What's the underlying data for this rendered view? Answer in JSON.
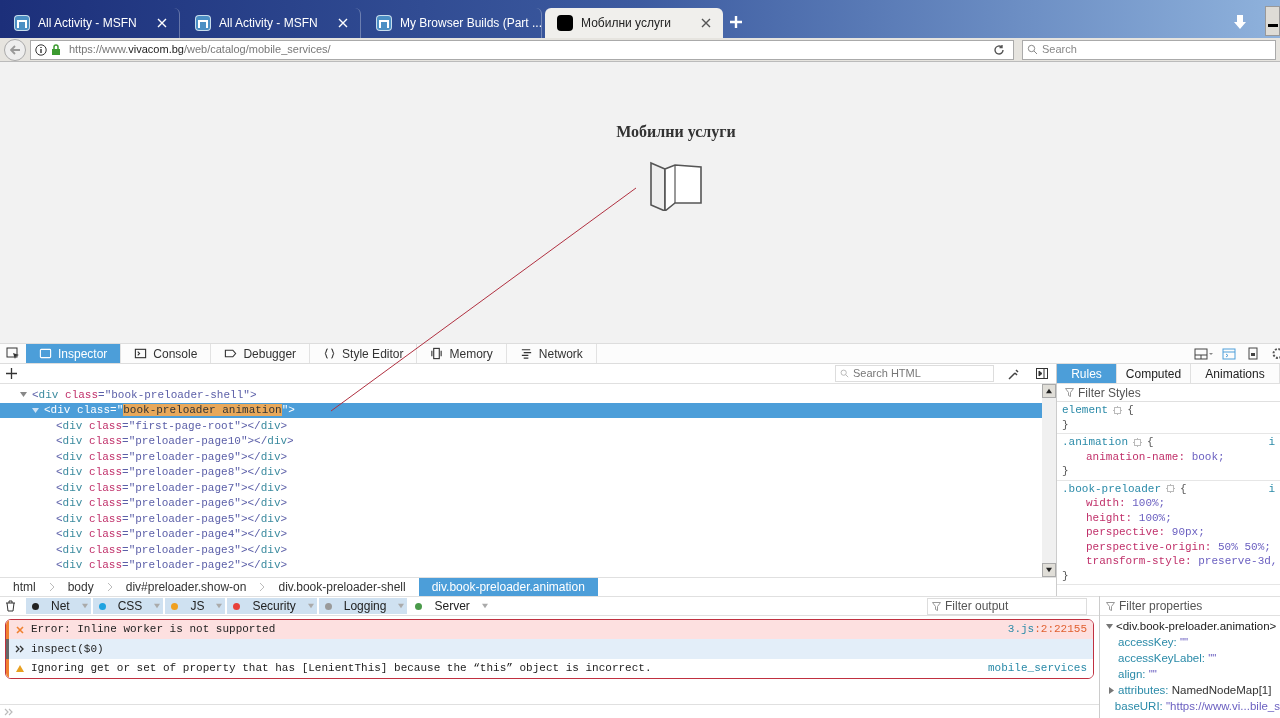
{
  "browser_tabs": [
    {
      "title": "All Activity - MSFN",
      "kind": "forum",
      "selected": false
    },
    {
      "title": "All Activity - MSFN",
      "kind": "forum",
      "selected": false
    },
    {
      "title": "My Browser Builds (Part ...",
      "kind": "forum",
      "selected": false
    },
    {
      "title": "Мобилни услуги",
      "kind": "dark",
      "selected": true
    }
  ],
  "address": {
    "prefix": "https://www.",
    "host": "vivacom.bg",
    "path": "/web/catalog/mobile_services/"
  },
  "search": {
    "placeholder": "Search"
  },
  "page": {
    "heading": "Мобилни услуги"
  },
  "devtools": {
    "tabs": [
      {
        "label": "Inspector",
        "kind": "inspector",
        "selected": true
      },
      {
        "label": "Console",
        "kind": "console",
        "selected": false
      },
      {
        "label": "Debugger",
        "kind": "debugger",
        "selected": false
      },
      {
        "label": "Style Editor",
        "kind": "braces",
        "selected": false
      },
      {
        "label": "Memory",
        "kind": "memory",
        "selected": false
      },
      {
        "label": "Network",
        "kind": "network",
        "selected": false
      }
    ],
    "markup": {
      "search_placeholder": "Search HTML",
      "nodes": [
        {
          "line": "<div class=\"book-preloader-shell\">",
          "expanded": true,
          "selected": false,
          "children": [
            {
              "line": "<div class=\"book-preloader animation\">",
              "expanded": true,
              "selected": true,
              "children": [
                {
                  "line": "<div class=\"first-page-root\"></div>",
                  "selected": false
                },
                {
                  "line": "<div class=\"preloader-page10\"></div>",
                  "selected": false
                },
                {
                  "line": "<div class=\"preloader-page9\"></div>",
                  "selected": false
                },
                {
                  "line": "<div class=\"preloader-page8\"></div>",
                  "selected": false
                },
                {
                  "line": "<div class=\"preloader-page7\"></div>",
                  "selected": false
                },
                {
                  "line": "<div class=\"preloader-page6\"></div>",
                  "selected": false
                },
                {
                  "line": "<div class=\"preloader-page5\"></div>",
                  "selected": false
                },
                {
                  "line": "<div class=\"preloader-page4\"></div>",
                  "selected": false
                },
                {
                  "line": "<div class=\"preloader-page3\"></div>",
                  "selected": false
                },
                {
                  "line": "<div class=\"preloader-page2\"></div>",
                  "selected": false
                }
              ]
            }
          ]
        }
      ]
    },
    "breadcrumbs": [
      {
        "label": "html",
        "selected": false
      },
      {
        "label": "body",
        "selected": false
      },
      {
        "label": "div#preloader.show-on",
        "selected": false
      },
      {
        "label": "div.book-preloader-shell",
        "selected": false
      },
      {
        "label": "div.book-preloader.animation",
        "selected": true
      }
    ],
    "sidebar": {
      "tabs": [
        {
          "label": "Rules",
          "selected": true
        },
        {
          "label": "Computed",
          "selected": false
        },
        {
          "label": "Animations",
          "selected": false
        }
      ],
      "filter_placeholder": "Filter Styles",
      "rules": [
        {
          "selector": "element",
          "open": "{",
          "close": "}"
        },
        {
          "selector": ".animation",
          "open": "{",
          "close": "}",
          "source": "i",
          "declarations": [
            "animation-name: book;"
          ]
        },
        {
          "selector": ".book-preloader",
          "open": "{",
          "close": "}",
          "source": "i",
          "declarations": [
            "width: 100%;",
            "height: 100%;",
            "perspective: 90px;",
            "perspective-origin: 50% 50%;",
            "transform-style: preserve-3d,"
          ]
        }
      ]
    },
    "console": {
      "filters": [
        {
          "label": "Net",
          "color": "#222222",
          "on": true
        },
        {
          "label": "CSS",
          "color": "#1fa2e0",
          "on": true
        },
        {
          "label": "JS",
          "color": "#f0a020",
          "on": true
        },
        {
          "label": "Security",
          "color": "#e8403a",
          "on": true
        },
        {
          "label": "Logging",
          "color": "#9a9a9a",
          "on": true
        },
        {
          "label": "Server",
          "color": "#4a9a4a",
          "on": false
        }
      ],
      "filter_placeholder": "Filter output",
      "messages": [
        {
          "kind": "error",
          "text": "Error: Inline worker is not supported",
          "source_file": "3.js",
          "source_location": ":2:22155"
        },
        {
          "kind": "input",
          "text": "inspect($0)"
        },
        {
          "kind": "warning",
          "text": "Ignoring get or set of property that has [LenientThis] because the “this” object is incorrect.",
          "source_file": "mobile_services"
        }
      ],
      "object": {
        "filter_placeholder": "Filter properties",
        "root": "<div.book-preloader.animation>",
        "properties": [
          {
            "row": "accessKey: \"\"",
            "expandable": false
          },
          {
            "row": "accessKeyLabel: \"\"",
            "expandable": false
          },
          {
            "row": "align: \"\"",
            "expandable": false
          },
          {
            "row": "attributes: NamedNodeMap[1]",
            "expandable": true
          },
          {
            "row": "baseURI: \"https://www.vi...bile_s",
            "expandable": false
          }
        ]
      }
    }
  }
}
